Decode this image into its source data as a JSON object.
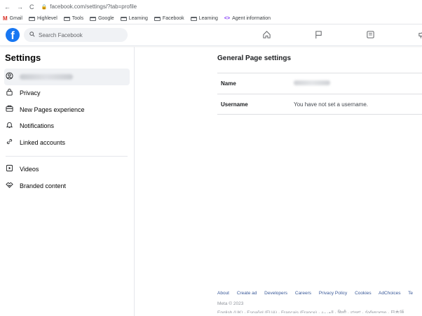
{
  "browser": {
    "url": "facebook.com/settings/?tab=profile",
    "bookmarks": [
      {
        "label": "Gmail",
        "type": "gmail"
      },
      {
        "label": "Highlevel",
        "type": "folder"
      },
      {
        "label": "Tools",
        "type": "folder"
      },
      {
        "label": "Google",
        "type": "folder"
      },
      {
        "label": "Learning",
        "type": "folder"
      },
      {
        "label": "Facebook",
        "type": "folder"
      },
      {
        "label": "Learning",
        "type": "folder"
      },
      {
        "label": "Agent information",
        "type": "agent"
      }
    ]
  },
  "topbar": {
    "logo": "f",
    "search_placeholder": "Search Facebook"
  },
  "sidebar": {
    "title": "Settings",
    "items": [
      {
        "label": "Privacy",
        "icon": "lock-icon"
      },
      {
        "label": "New Pages experience",
        "icon": "pages-icon"
      },
      {
        "label": "Notifications",
        "icon": "bell-icon"
      },
      {
        "label": "Linked accounts",
        "icon": "link-icon"
      },
      {
        "label": "Videos",
        "icon": "video-icon"
      },
      {
        "label": "Branded content",
        "icon": "handshake-icon"
      }
    ]
  },
  "main": {
    "title": "General Page settings",
    "rows": [
      {
        "label": "Name",
        "value": ""
      },
      {
        "label": "Username",
        "value": "You have not set a username."
      }
    ]
  },
  "footer": {
    "links": [
      "About",
      "Create ad",
      "Developers",
      "Careers",
      "Privacy Policy",
      "Cookies",
      "AdChoices",
      "Te"
    ],
    "copyright": "Meta © 2023",
    "languages": "English (UK) · Español (EUA) · Français (France) · العربية · हिन्दी · বাংলা · ქართული · 日本語"
  },
  "colors": {
    "accent": "#1877f2",
    "footer_link": "#385898"
  }
}
